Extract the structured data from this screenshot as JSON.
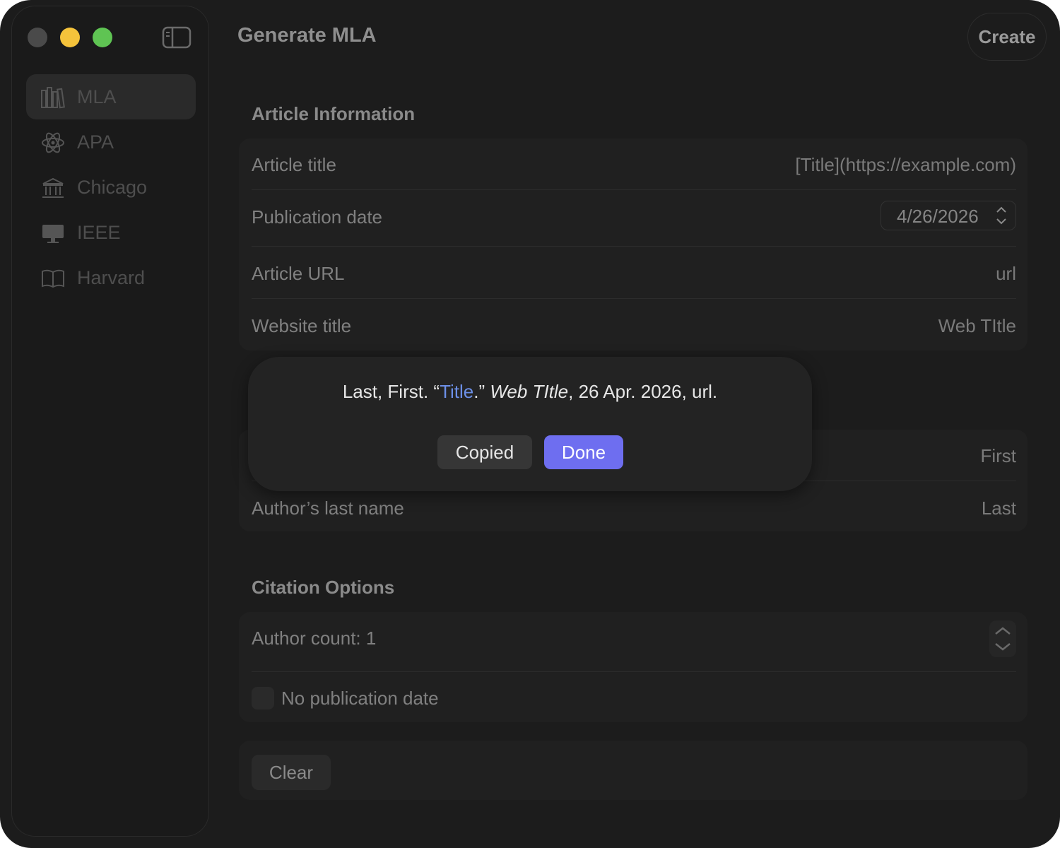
{
  "window": {
    "title": "Generate MLA"
  },
  "toolbar": {
    "create_label": "Create"
  },
  "sidebar": {
    "items": [
      {
        "label": "MLA",
        "icon": "books-icon",
        "active": true
      },
      {
        "label": "APA",
        "icon": "atom-icon",
        "active": false
      },
      {
        "label": "Chicago",
        "icon": "building-columns-icon",
        "active": false
      },
      {
        "label": "IEEE",
        "icon": "desktop-icon",
        "active": false
      },
      {
        "label": "Harvard",
        "icon": "book-icon",
        "active": false
      }
    ]
  },
  "article": {
    "section_title": "Article Information",
    "title_label": "Article title",
    "title_value": "[Title](https://example.com)",
    "date_label": "Publication date",
    "date_value": "4/26/2026",
    "url_label": "Article URL",
    "url_value": "url",
    "website_label": "Website title",
    "website_value": "Web TItle"
  },
  "author": {
    "first_value": "First",
    "last_label": "Author’s last name",
    "last_value": "Last"
  },
  "options": {
    "section_title": "Citation Options",
    "author_count_label": "Author count: 1",
    "no_date_label": "No publication date"
  },
  "actions": {
    "clear_label": "Clear"
  },
  "popover": {
    "citation_prefix": "Last, First. “",
    "citation_link": "Title",
    "citation_mid": ".” ",
    "citation_site": "Web TItle",
    "citation_suffix": ", 26 Apr. 2026, url.",
    "copied_label": "Copied",
    "done_label": "Done"
  },
  "colors": {
    "accent": "#6e6ef0",
    "link": "#6c8fe6",
    "background": "#1c1c1c"
  }
}
